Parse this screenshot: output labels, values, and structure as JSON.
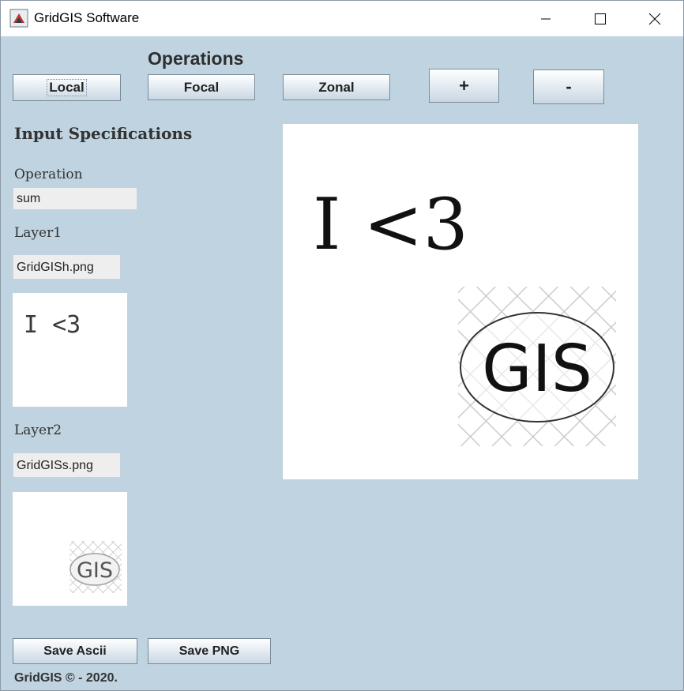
{
  "window": {
    "title": "GridGIS Software",
    "icon": "java-coffee-icon",
    "controls": [
      "minimize-icon",
      "maximize-icon",
      "close-icon"
    ]
  },
  "operations": {
    "heading": "Operations",
    "buttons": [
      {
        "label": "Local"
      },
      {
        "label": "Focal"
      },
      {
        "label": "Zonal"
      },
      {
        "label": "+"
      },
      {
        "label": "-"
      }
    ]
  },
  "input": {
    "heading": "Input Specifications",
    "operation_label": "Operation",
    "operation_value": "sum",
    "layer1_label": "Layer1",
    "layer1_value": "GridGISh.png",
    "layer2_label": "Layer2",
    "layer2_value": "GridGISs.png"
  },
  "images": {
    "layer1_text": "I <3",
    "layer2_text": "GIS",
    "result_text": "I <3",
    "result_logo_text": "GIS"
  },
  "actions": {
    "save_ascii": "Save Ascii",
    "save_png": "Save PNG"
  },
  "footer": "GridGIS © - 2020.",
  "colors": {
    "background": "#bfd3e0",
    "button_border": "#7a8a99"
  }
}
